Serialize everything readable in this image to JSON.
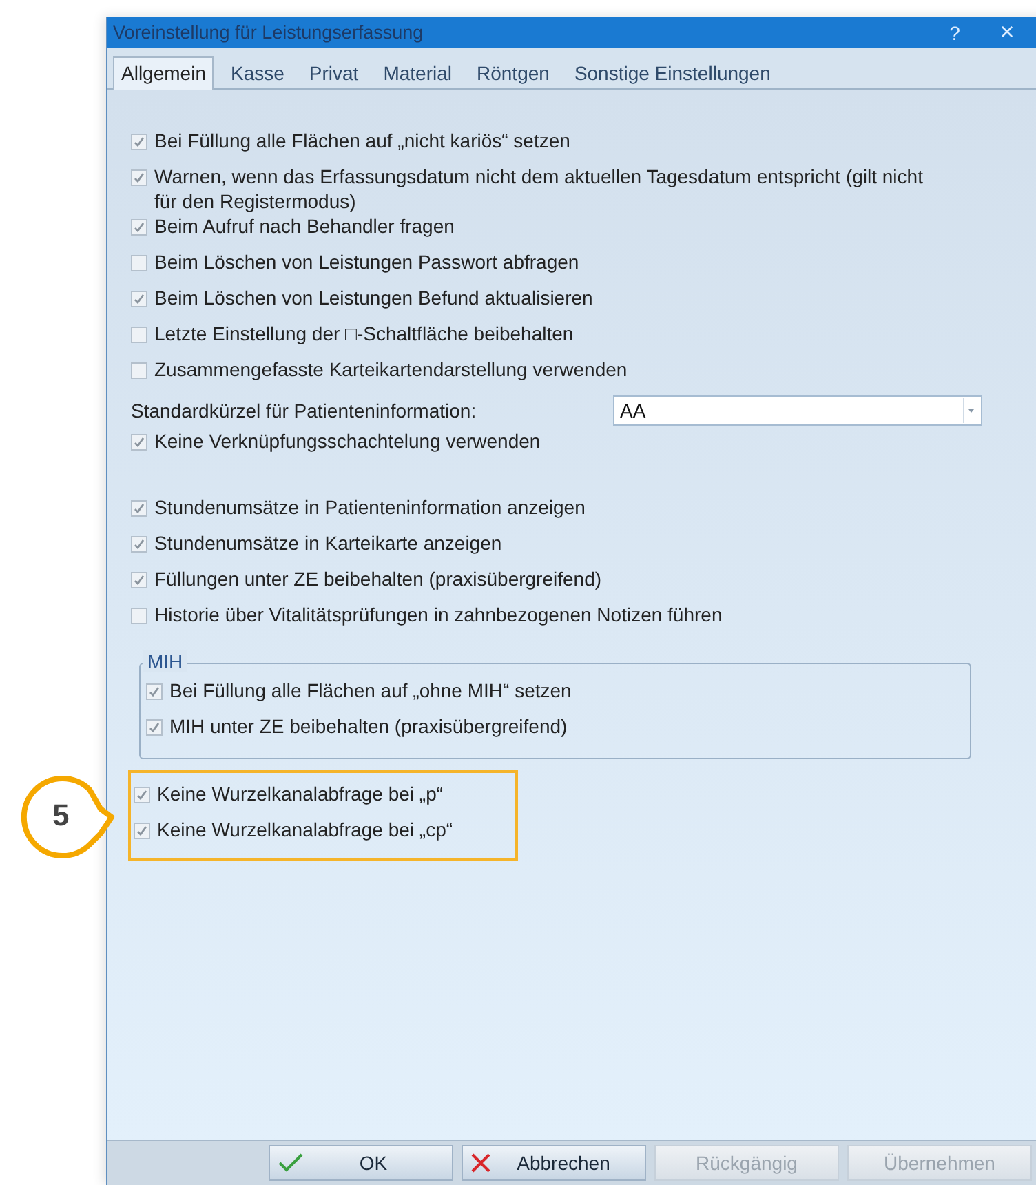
{
  "window": {
    "title": "Voreinstellung für Leistungserfassung",
    "help": "?",
    "close": "×"
  },
  "tabs": [
    {
      "label": "Allgemein",
      "selected": true
    },
    {
      "label": "Kasse",
      "selected": false
    },
    {
      "label": "Privat",
      "selected": false
    },
    {
      "label": "Material",
      "selected": false
    },
    {
      "label": "Röntgen",
      "selected": false
    },
    {
      "label": "Sonstige Einstellungen",
      "selected": false
    }
  ],
  "sections": [
    {
      "kind": "plain",
      "items": [
        {
          "kind": "checkbox",
          "label": "Bei Füllung alle Flächen auf „nicht kariös“ setzen",
          "checked": true
        },
        {
          "kind": "checkbox",
          "label": "Warnen, wenn das Erfassungsdatum nicht dem aktuellen Tagesdatum entspricht (gilt nicht für den Registermodus)",
          "checked": true
        },
        {
          "kind": "checkbox",
          "label": "Beim Aufruf nach Behandler fragen",
          "checked": true
        },
        {
          "kind": "checkbox",
          "label": "Beim Löschen von Leistungen Passwort abfragen",
          "checked": false
        },
        {
          "kind": "checkbox",
          "label": "Beim Löschen von Leistungen Befund aktualisieren",
          "checked": true
        },
        {
          "kind": "checkbox",
          "label": "Letzte Einstellung der □-Schaltfläche beibehalten",
          "checked": false
        },
        {
          "kind": "checkbox",
          "label": "Zusammengefasste Karteikartendarstellung verwenden",
          "checked": false
        },
        {
          "kind": "select",
          "label": "Standardkürzel für Patienteninformation:",
          "value": "AA"
        },
        {
          "kind": "checkbox",
          "label": "Keine Verknüpfungsschachtelung verwenden",
          "checked": true
        }
      ]
    },
    {
      "kind": "plain",
      "items": [
        {
          "kind": "checkbox",
          "label": "Stundenumsätze in Patienteninformation anzeigen",
          "checked": true
        },
        {
          "kind": "checkbox",
          "label": "Stundenumsätze in Karteikarte anzeigen",
          "checked": true
        },
        {
          "kind": "checkbox",
          "label": "Füllungen unter ZE beibehalten (praxisübergreifend)",
          "checked": true
        },
        {
          "kind": "checkbox",
          "label": "Historie über Vitalitätsprüfungen in zahnbezogenen Notizen führen",
          "checked": false
        }
      ]
    },
    {
      "kind": "group",
      "legend": "MIH",
      "items": [
        {
          "kind": "checkbox",
          "label": "Bei Füllung alle Flächen auf „ohne MIH“ setzen",
          "checked": true
        },
        {
          "kind": "checkbox",
          "label": "MIH unter ZE beibehalten (praxisübergreifend)",
          "checked": true
        }
      ]
    },
    {
      "kind": "highlight",
      "callout": "5",
      "items": [
        {
          "kind": "checkbox",
          "label": "Keine Wurzelkanalabfrage bei „p“",
          "checked": true
        },
        {
          "kind": "checkbox",
          "label": "Keine Wurzelkanalabfrage bei „cp“",
          "checked": true
        }
      ]
    }
  ],
  "buttons": [
    {
      "label": "OK",
      "kind": "confirm",
      "disabled": false
    },
    {
      "label": "Abbrechen",
      "kind": "cancel",
      "disabled": false
    },
    {
      "label": "Rückgängig",
      "kind": "plain",
      "disabled": true
    },
    {
      "label": "Übernehmen",
      "kind": "plain",
      "disabled": true
    }
  ]
}
